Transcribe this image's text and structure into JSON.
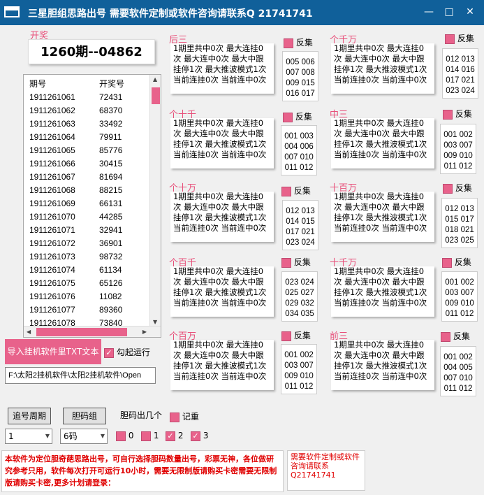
{
  "window": {
    "title": "三星胆组思路出号 需要软件定制或软件咨询请联系Q 21741741",
    "minimize": "—",
    "maximize": "□",
    "close": "✕"
  },
  "draw": {
    "label": "开奖",
    "current": "1260期--04862"
  },
  "table": {
    "headers": [
      "期号",
      "开奖号"
    ],
    "rows": [
      [
        "1911261061",
        "72431"
      ],
      [
        "1911261062",
        "68370"
      ],
      [
        "1911261063",
        "33492"
      ],
      [
        "1911261064",
        "79911"
      ],
      [
        "1911261065",
        "85776"
      ],
      [
        "1911261066",
        "30415"
      ],
      [
        "1911261067",
        "81694"
      ],
      [
        "1911261068",
        "88215"
      ],
      [
        "1911261069",
        "66131"
      ],
      [
        "1911261070",
        "44285"
      ],
      [
        "1911261071",
        "32941"
      ],
      [
        "1911261072",
        "36901"
      ],
      [
        "1911261073",
        "98732"
      ],
      [
        "1911261074",
        "61134"
      ],
      [
        "1911261075",
        "65126"
      ],
      [
        "1911261076",
        "11082"
      ],
      [
        "1911261077",
        "89360"
      ],
      [
        "1911261078",
        "73840"
      ]
    ]
  },
  "controls": {
    "import_label": "导入挂机软件里TXT文本",
    "auto_run_label": "勾起运行",
    "path": "F:\\太阳2挂机软件\\太阳2挂机软件\\Open",
    "track_period_label": "追号周期",
    "dan_group_label": "胆码组",
    "dan_count_label": "胆码出几个",
    "record_label": "记重",
    "period_select": "1",
    "code_select": "6码",
    "options": [
      {
        "label": "0",
        "checked": false
      },
      {
        "label": "1",
        "checked": false
      },
      {
        "label": "2",
        "checked": true
      },
      {
        "label": "3",
        "checked": true
      }
    ]
  },
  "fanji_label": "反集",
  "panels": [
    {
      "title": "后三",
      "stats": "1期里共中0次 最大连挂0次 最大连中0次 最大中跟挂停1次 最大推波模式1次 当前连挂0次 当前连中0次",
      "nums": [
        "005 006",
        "007 008",
        "009 015",
        "016 017"
      ]
    },
    {
      "title": "个千万",
      "stats": "1期里共中0次 最大连挂0次 最大连中0次 最大中跟挂停1次 最大推波模式1次 当前连挂0次 当前连中0次",
      "nums": [
        "012 013",
        "014 016",
        "017 021",
        "023 024"
      ]
    },
    {
      "title": "个十千",
      "stats": "1期里共中0次 最大连挂0次 最大连中0次 最大中跟挂停1次 最大推波模式1次 当前连挂0次 当前连中0次",
      "nums": [
        "001 003",
        "004 006",
        "007 010",
        "011 012"
      ]
    },
    {
      "title": "中三",
      "stats": "1期里共中0次 最大连挂0次 最大连中0次 最大中跟挂停1次 最大推波模式1次 当前连挂0次 当前连中0次",
      "nums": [
        "001 002",
        "003 007",
        "009 010",
        "011 012"
      ]
    },
    {
      "title": "个十万",
      "stats": "1期里共中0次 最大连挂0次 最大连中0次 最大中跟挂停1次 最大推波模式1次 当前连挂0次 当前连中0次",
      "nums": [
        "012 013",
        "014 015",
        "017 021",
        "023 024"
      ]
    },
    {
      "title": "十百万",
      "stats": "1期里共中0次 最大连挂0次 最大连中0次 最大中跟挂停1次 最大推波模式1次 当前连挂0次 当前连中0次",
      "nums": [
        "012 013",
        "015 017",
        "018 021",
        "023 025"
      ]
    },
    {
      "title": "个百千",
      "stats": "1期里共中0次 最大连挂0次 最大连中0次 最大中跟挂停1次 最大推波模式1次 当前连挂0次 当前连中0次",
      "nums": [
        "023 024",
        "025 027",
        "029 032",
        "034 035"
      ]
    },
    {
      "title": "十千万",
      "stats": "1期里共中0次 最大连挂0次 最大连中0次 最大中跟挂停1次 最大推波模式1次 当前连挂0次 当前连中0次",
      "nums": [
        "001 002",
        "003 007",
        "009 010",
        "011 012"
      ]
    },
    {
      "title": "个百万",
      "stats": "1期里共中0次 最大连挂0次 最大连中0次 最大中跟挂停1次 最大推波模式1次 当前连挂0次 当前连中0次",
      "nums": [
        "001 002",
        "003 007",
        "009 010",
        "011 012"
      ]
    },
    {
      "title": "前三",
      "stats": "1期里共中0次 最大连挂0次 最大连中0次 最大中跟挂停1次 最大推波模式1次 当前连挂0次 当前连中0次",
      "nums": [
        "001 002",
        "004 005",
        "007 010",
        "011 012"
      ]
    }
  ],
  "notice": {
    "main": "本软件为定位胆奇葩思路出号，可自行选择胆码数量出号，彩票无神，各位做研究参考只用，软件每次打开可运行10小时，需要无限制版请购买卡密需要无限制版请购买卡密,更多计划请登录：",
    "contact": "需要软件定制或软件咨询请联系 Q21741741"
  },
  "colors": {
    "accent": "#e8628b",
    "titlebar": "#10609a",
    "notice": "#e00000"
  }
}
